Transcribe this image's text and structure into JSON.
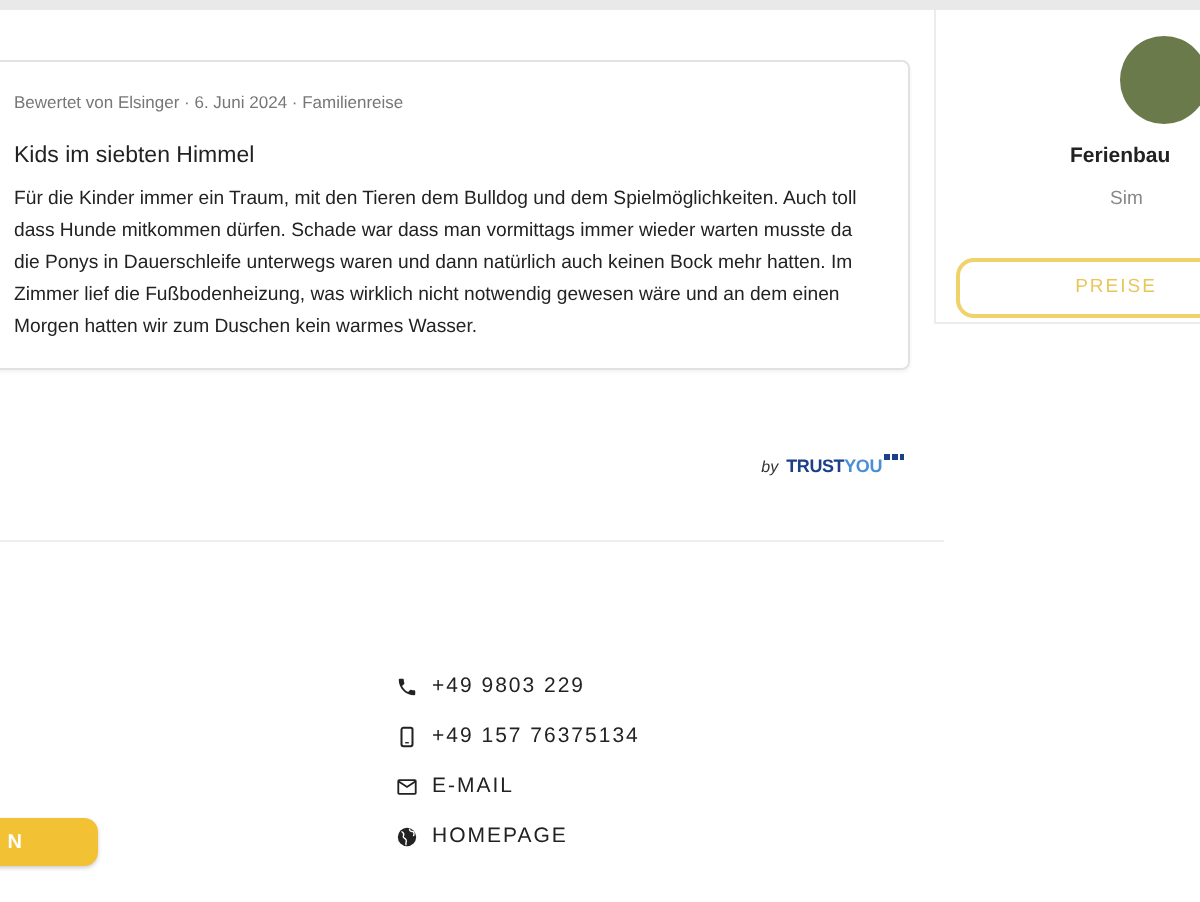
{
  "review": {
    "meta": "Bewertet von Elsinger · 6. Juni 2024 · Familienreise",
    "title": "Kids im siebten Himmel",
    "text": "Für die Kinder immer ein Traum, mit den Tieren dem Bulldog und dem Spielmöglichkeiten. Auch toll dass Hunde mitkommen dürfen. Schade war dass man vormittags immer wieder warten musste da die Ponys in Dauerschleife unterwegs waren und dann natürlich auch keinen Bock mehr hatten. Im Zimmer lief die Fußbodenheizung, was wirklich nicht notwendig gewesen wäre und an dem einen Morgen hatten wir zum Duschen kein warmes Wasser."
  },
  "review_source": {
    "prefix": "by",
    "brand": [
      "TRUST",
      "YOU"
    ]
  },
  "contact_button": {
    "label": "N"
  },
  "contacts": [
    {
      "kind": "phone",
      "label": "+49 9803 229"
    },
    {
      "kind": "mobile",
      "label": "+49 157 76375134"
    },
    {
      "kind": "email",
      "label": "E-MAIL"
    },
    {
      "kind": "web",
      "label": "HOMEPAGE"
    }
  ],
  "host_card": {
    "name": "Ferienbau",
    "subtitle": "Sim",
    "button": "PREISE"
  }
}
